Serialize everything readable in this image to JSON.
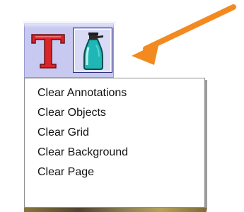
{
  "toolbar": {
    "text_tool_icon": "text-tool-icon",
    "clear_tool_icon": "spray-bottle-icon"
  },
  "menu": {
    "items": [
      {
        "label": "Clear Annotations"
      },
      {
        "label": "Clear Objects"
      },
      {
        "label": "Clear Grid"
      },
      {
        "label": "Clear Background"
      },
      {
        "label": "Clear Page"
      }
    ]
  },
  "colors": {
    "accent_arrow": "#f28a1f",
    "toolbar_bg": "#c7c9f1",
    "text_icon_red": "#d9242a",
    "bottle_teal": "#1fb6b5"
  }
}
